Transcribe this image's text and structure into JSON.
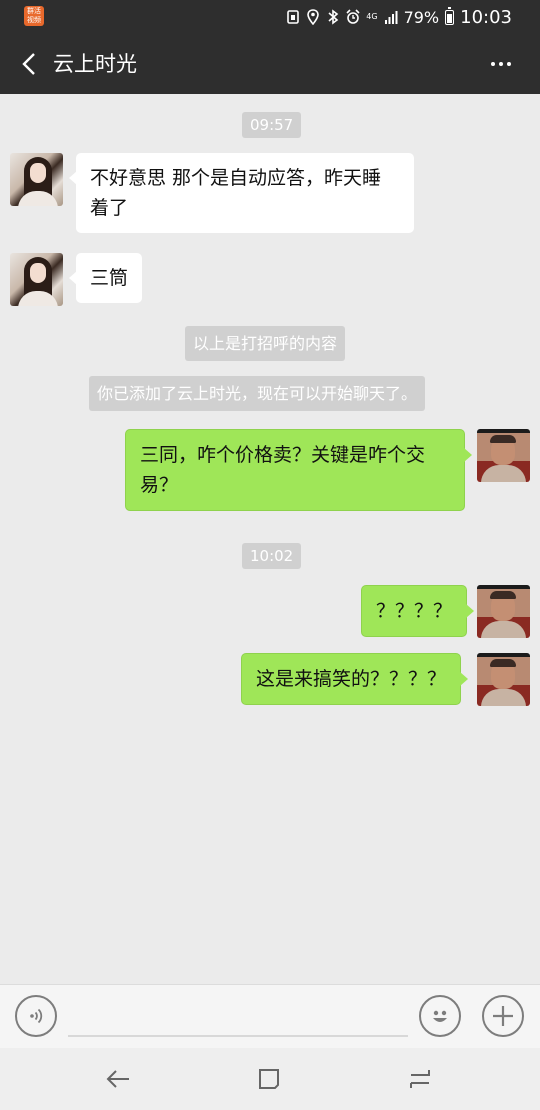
{
  "status_bar": {
    "app_badge": "群活\n视频",
    "network": "4G",
    "battery": "79%",
    "time": "10:03"
  },
  "header": {
    "title": "云上时光"
  },
  "messages": {
    "time1": "09:57",
    "msg1": "不好意思  那个是自动应答，昨天睡着了",
    "msg2": "三筒",
    "sys1": "以上是打招呼的内容",
    "sys2": "你已添加了云上时光，现在可以开始聊天了。",
    "msg3": "三同，咋个价格卖？关键是咋个交易？",
    "time2": "10:02",
    "msg4": "？？？？",
    "msg5": "这是来搞笑的？？？？"
  },
  "colors": {
    "bar": "#2e2e2e",
    "chat_bg": "#ebebeb",
    "sent_bubble": "#9fe658",
    "received_bubble": "#ffffff"
  }
}
